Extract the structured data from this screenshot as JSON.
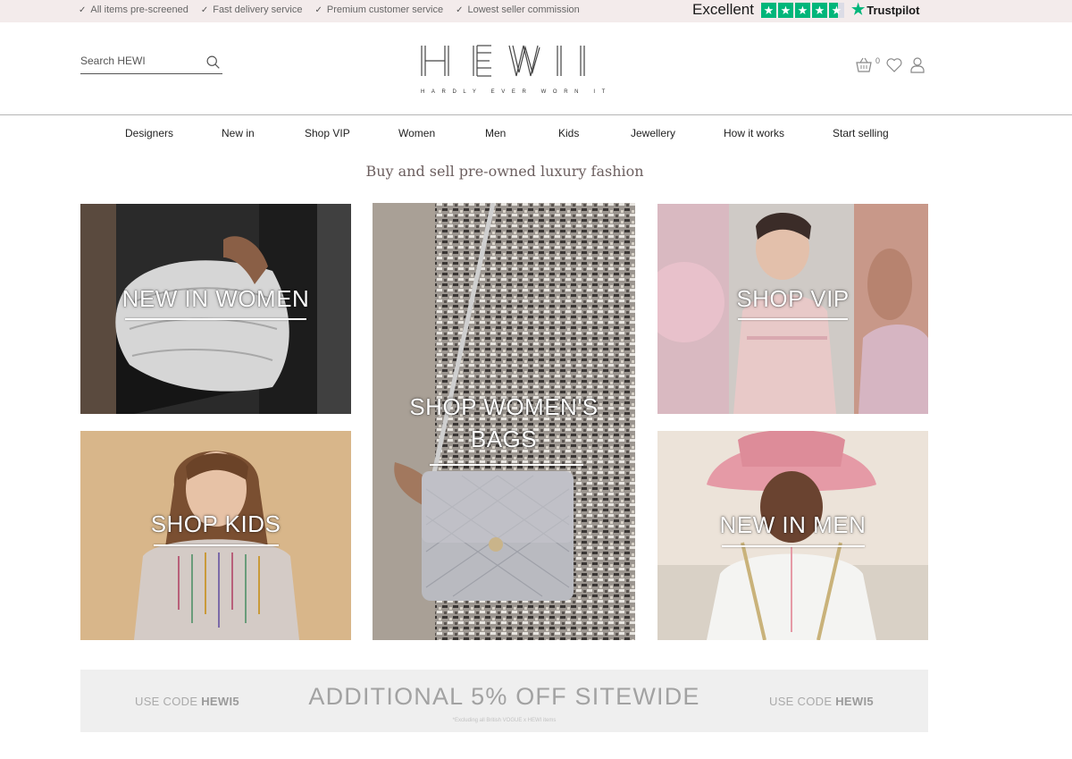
{
  "topbar": {
    "usps": [
      "All items pre-screened",
      "Fast delivery service",
      "Premium customer service",
      "Lowest seller commission"
    ],
    "trust_label": "Excellent",
    "trust_brand": "Trustpilot",
    "trust_color": "#00b67a",
    "trust_rating_stars": 4.5
  },
  "header": {
    "search_placeholder": "Search HEWI",
    "logo_tagline": "HARDLY EVER WORN IT",
    "basket_count": "0"
  },
  "nav": {
    "items": [
      "Designers",
      "New in",
      "Shop VIP",
      "Women",
      "Men",
      "Kids",
      "Jewellery",
      "How it works",
      "Start selling"
    ]
  },
  "tagline": "Buy and sell pre-owned luxury fashion",
  "tiles": {
    "new_in_women": "NEW IN WOMEN",
    "shop_womens_bags_1": "SHOP WOMEN'S",
    "shop_womens_bags_2": "BAGS",
    "shop_vip": "SHOP VIP",
    "shop_kids": "SHOP KIDS",
    "new_in_men": "NEW IN MEN"
  },
  "promo": {
    "left_prefix": "USE CODE ",
    "left_code": "HEWI5",
    "headline": "ADDITIONAL 5% OFF SITEWIDE",
    "right_prefix": "USE CODE ",
    "right_code": "HEWI5",
    "fineprint": "*Excluding all British VOGUE x HEWI items"
  }
}
